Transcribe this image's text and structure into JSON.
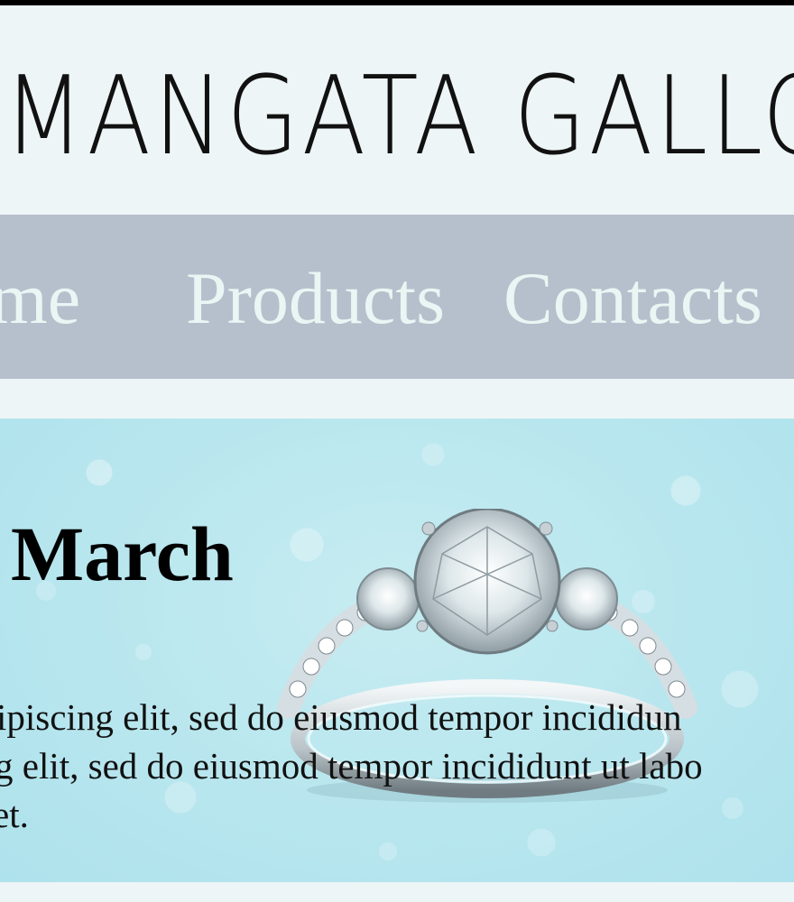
{
  "header": {
    "logo_text": "MANGATA GALLO"
  },
  "nav": {
    "items": [
      {
        "label": "ome"
      },
      {
        "label": "Products"
      },
      {
        "label": "Contacts"
      }
    ]
  },
  "hero": {
    "title": "March",
    "image": "diamond-ring",
    "body_lines": [
      "ipiscing elit, sed do eiusmod tempor incididun",
      "g elit, sed do eiusmod tempor incididunt ut labo",
      "et."
    ]
  },
  "colors": {
    "page_bg": "#eef5f6",
    "nav_bg": "#b6c0cc",
    "nav_text": "#e9f6f4",
    "hero_bg": "#b8e6ee"
  }
}
